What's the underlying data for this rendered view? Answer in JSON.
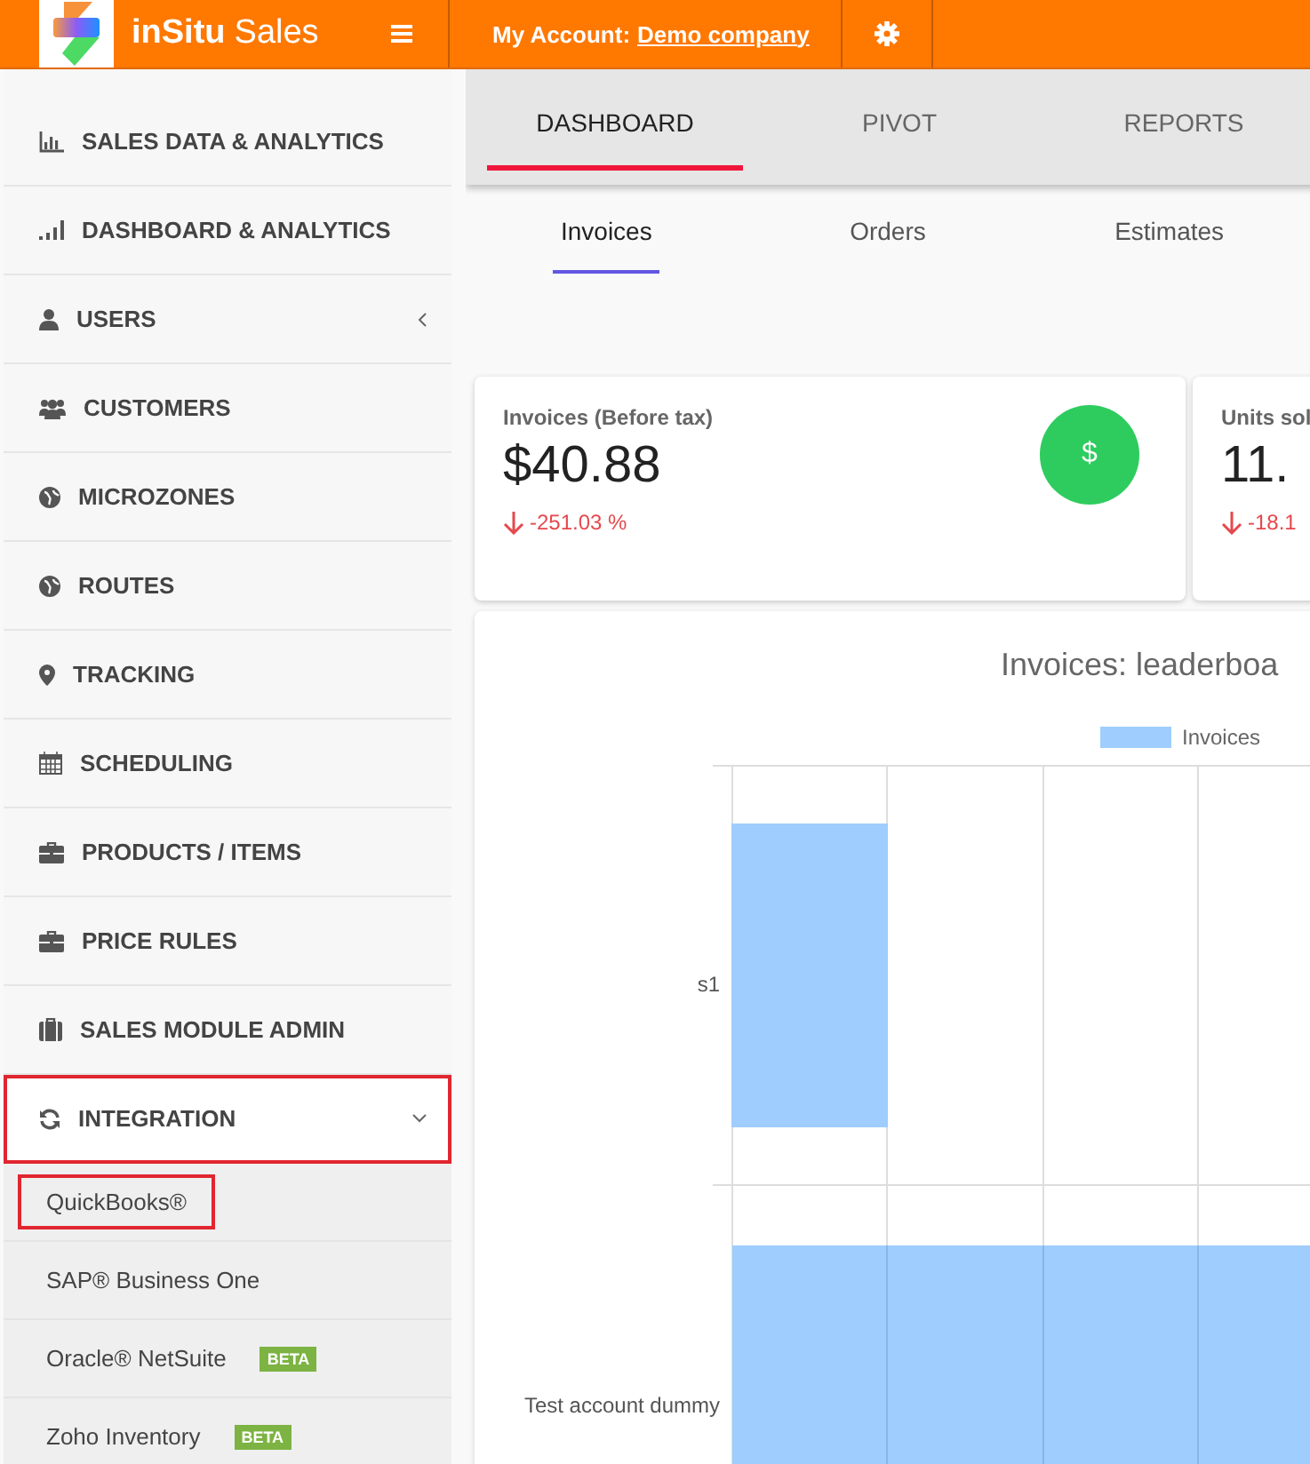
{
  "header": {
    "brand_bold": "inSitu",
    "brand_light": "Sales",
    "account_label": "My Account:",
    "account_link": "Demo company"
  },
  "sidebar": {
    "items": [
      {
        "label": "SALES DATA & ANALYTICS",
        "highlighted": false
      },
      {
        "label": "DASHBOARD & ANALYTICS",
        "highlighted": false
      },
      {
        "label": "USERS",
        "expanded": false,
        "highlighted": false
      },
      {
        "label": "CUSTOMERS",
        "highlighted": false
      },
      {
        "label": "MICROZONES",
        "highlighted": false
      },
      {
        "label": "ROUTES",
        "highlighted": false
      },
      {
        "label": "TRACKING",
        "highlighted": false
      },
      {
        "label": "SCHEDULING",
        "highlighted": false
      },
      {
        "label": "PRODUCTS / ITEMS",
        "highlighted": false
      },
      {
        "label": "PRICE RULES",
        "highlighted": false
      },
      {
        "label": "SALES MODULE ADMIN",
        "highlighted": false
      },
      {
        "label": "INTEGRATION",
        "expanded": true,
        "highlighted": true,
        "children": [
          {
            "label": "QuickBooks®",
            "highlighted": true
          },
          {
            "label": "SAP® Business One",
            "highlighted": false
          },
          {
            "label": "Oracle® NetSuite",
            "badge": "BETA",
            "highlighted": false
          },
          {
            "label": "Zoho Inventory",
            "badge": "BETA",
            "highlighted": false
          }
        ]
      }
    ]
  },
  "tabs": [
    {
      "label": "DASHBOARD",
      "selected": true
    },
    {
      "label": "PIVOT",
      "selected": false
    },
    {
      "label": "REPORTS",
      "selected": false
    }
  ],
  "subtabs": [
    {
      "label": "Invoices",
      "selected": true
    },
    {
      "label": "Orders",
      "selected": false
    },
    {
      "label": "Estimates",
      "selected": false
    }
  ],
  "cards": [
    {
      "title": "Invoices (Before tax)",
      "value": "$40.88",
      "change": "-251.03 %",
      "decreased": true,
      "badge": "$"
    },
    {
      "title": "Units sol",
      "value": "11.",
      "change": "-18.1",
      "decreased": true
    }
  ],
  "chart": {
    "title": "Invoices: leaderboa",
    "legend": "Invoices",
    "row_labels": [
      "s1",
      "Test account dummy"
    ]
  }
}
